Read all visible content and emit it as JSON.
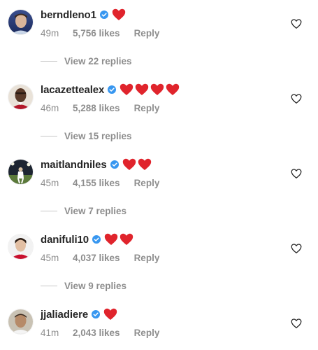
{
  "comments": [
    {
      "username": "berndleno1",
      "verified": true,
      "hearts": 1,
      "time": "49m",
      "likes": "5,756 likes",
      "reply_label": "Reply",
      "view_replies": "View 22 replies"
    },
    {
      "username": "lacazettealex",
      "verified": true,
      "hearts": 4,
      "time": "46m",
      "likes": "5,288 likes",
      "reply_label": "Reply",
      "view_replies": "View 15 replies"
    },
    {
      "username": "maitlandniles",
      "verified": true,
      "hearts": 2,
      "time": "45m",
      "likes": "4,155 likes",
      "reply_label": "Reply",
      "view_replies": "View 7 replies"
    },
    {
      "username": "danifuli10",
      "verified": true,
      "hearts": 2,
      "time": "45m",
      "likes": "4,037 likes",
      "reply_label": "Reply",
      "view_replies": "View 9 replies"
    },
    {
      "username": "jjaliadiere",
      "verified": true,
      "hearts": 1,
      "time": "41m",
      "likes": "2,043 likes",
      "reply_label": "Reply"
    }
  ],
  "icons": {
    "verified": "verified-badge-icon",
    "emoji": "red-heart-emoji",
    "like": "heart-outline-icon"
  },
  "colors": {
    "verified_blue": "#3897f0",
    "heart_red": "#e0242c",
    "meta_gray": "#8e8e8e",
    "text": "#262626"
  }
}
